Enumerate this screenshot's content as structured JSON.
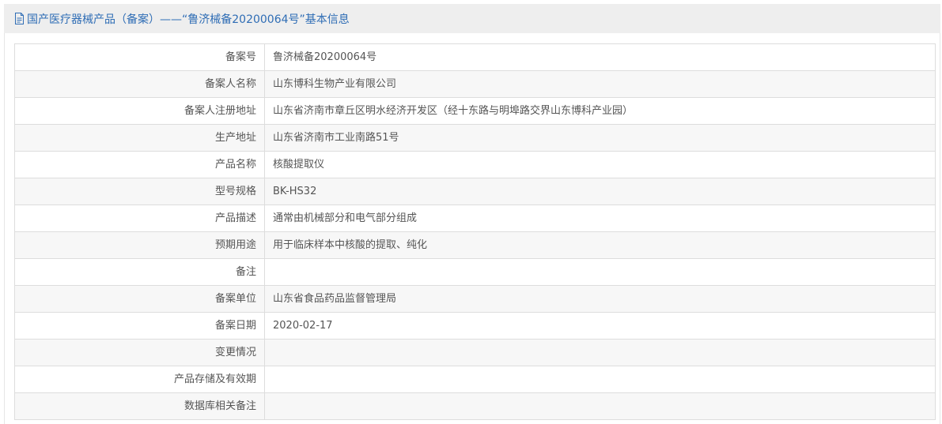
{
  "header": {
    "icon": "document-icon",
    "title": "国产医疗器械产品（备案）——“鲁济械备20200064号”基本信息"
  },
  "colors": {
    "title": "#2f6db5",
    "header_bg": "#eeeeee",
    "row_alt_bg": "#f7f7f7",
    "border": "#dddddd",
    "text": "#555555"
  },
  "rows": [
    {
      "label": "备案号",
      "value": "鲁济械备20200064号"
    },
    {
      "label": "备案人名称",
      "value": "山东博科生物产业有限公司"
    },
    {
      "label": "备案人注册地址",
      "value": "山东省济南市章丘区明水经济开发区（经十东路与明埠路交界山东博科产业园）"
    },
    {
      "label": "生产地址",
      "value": "山东省济南市工业南路51号"
    },
    {
      "label": "产品名称",
      "value": "核酸提取仪"
    },
    {
      "label": "型号规格",
      "value": "BK-HS32"
    },
    {
      "label": "产品描述",
      "value": "通常由机械部分和电气部分组成"
    },
    {
      "label": "预期用途",
      "value": "用于临床样本中核酸的提取、纯化"
    },
    {
      "label": "备注",
      "value": ""
    },
    {
      "label": "备案单位",
      "value": "山东省食品药品监督管理局"
    },
    {
      "label": "备案日期",
      "value": "2020-02-17"
    },
    {
      "label": "变更情况",
      "value": ""
    },
    {
      "label": "产品存储及有效期",
      "value": ""
    },
    {
      "label": "数据库相关备注",
      "value": ""
    }
  ]
}
